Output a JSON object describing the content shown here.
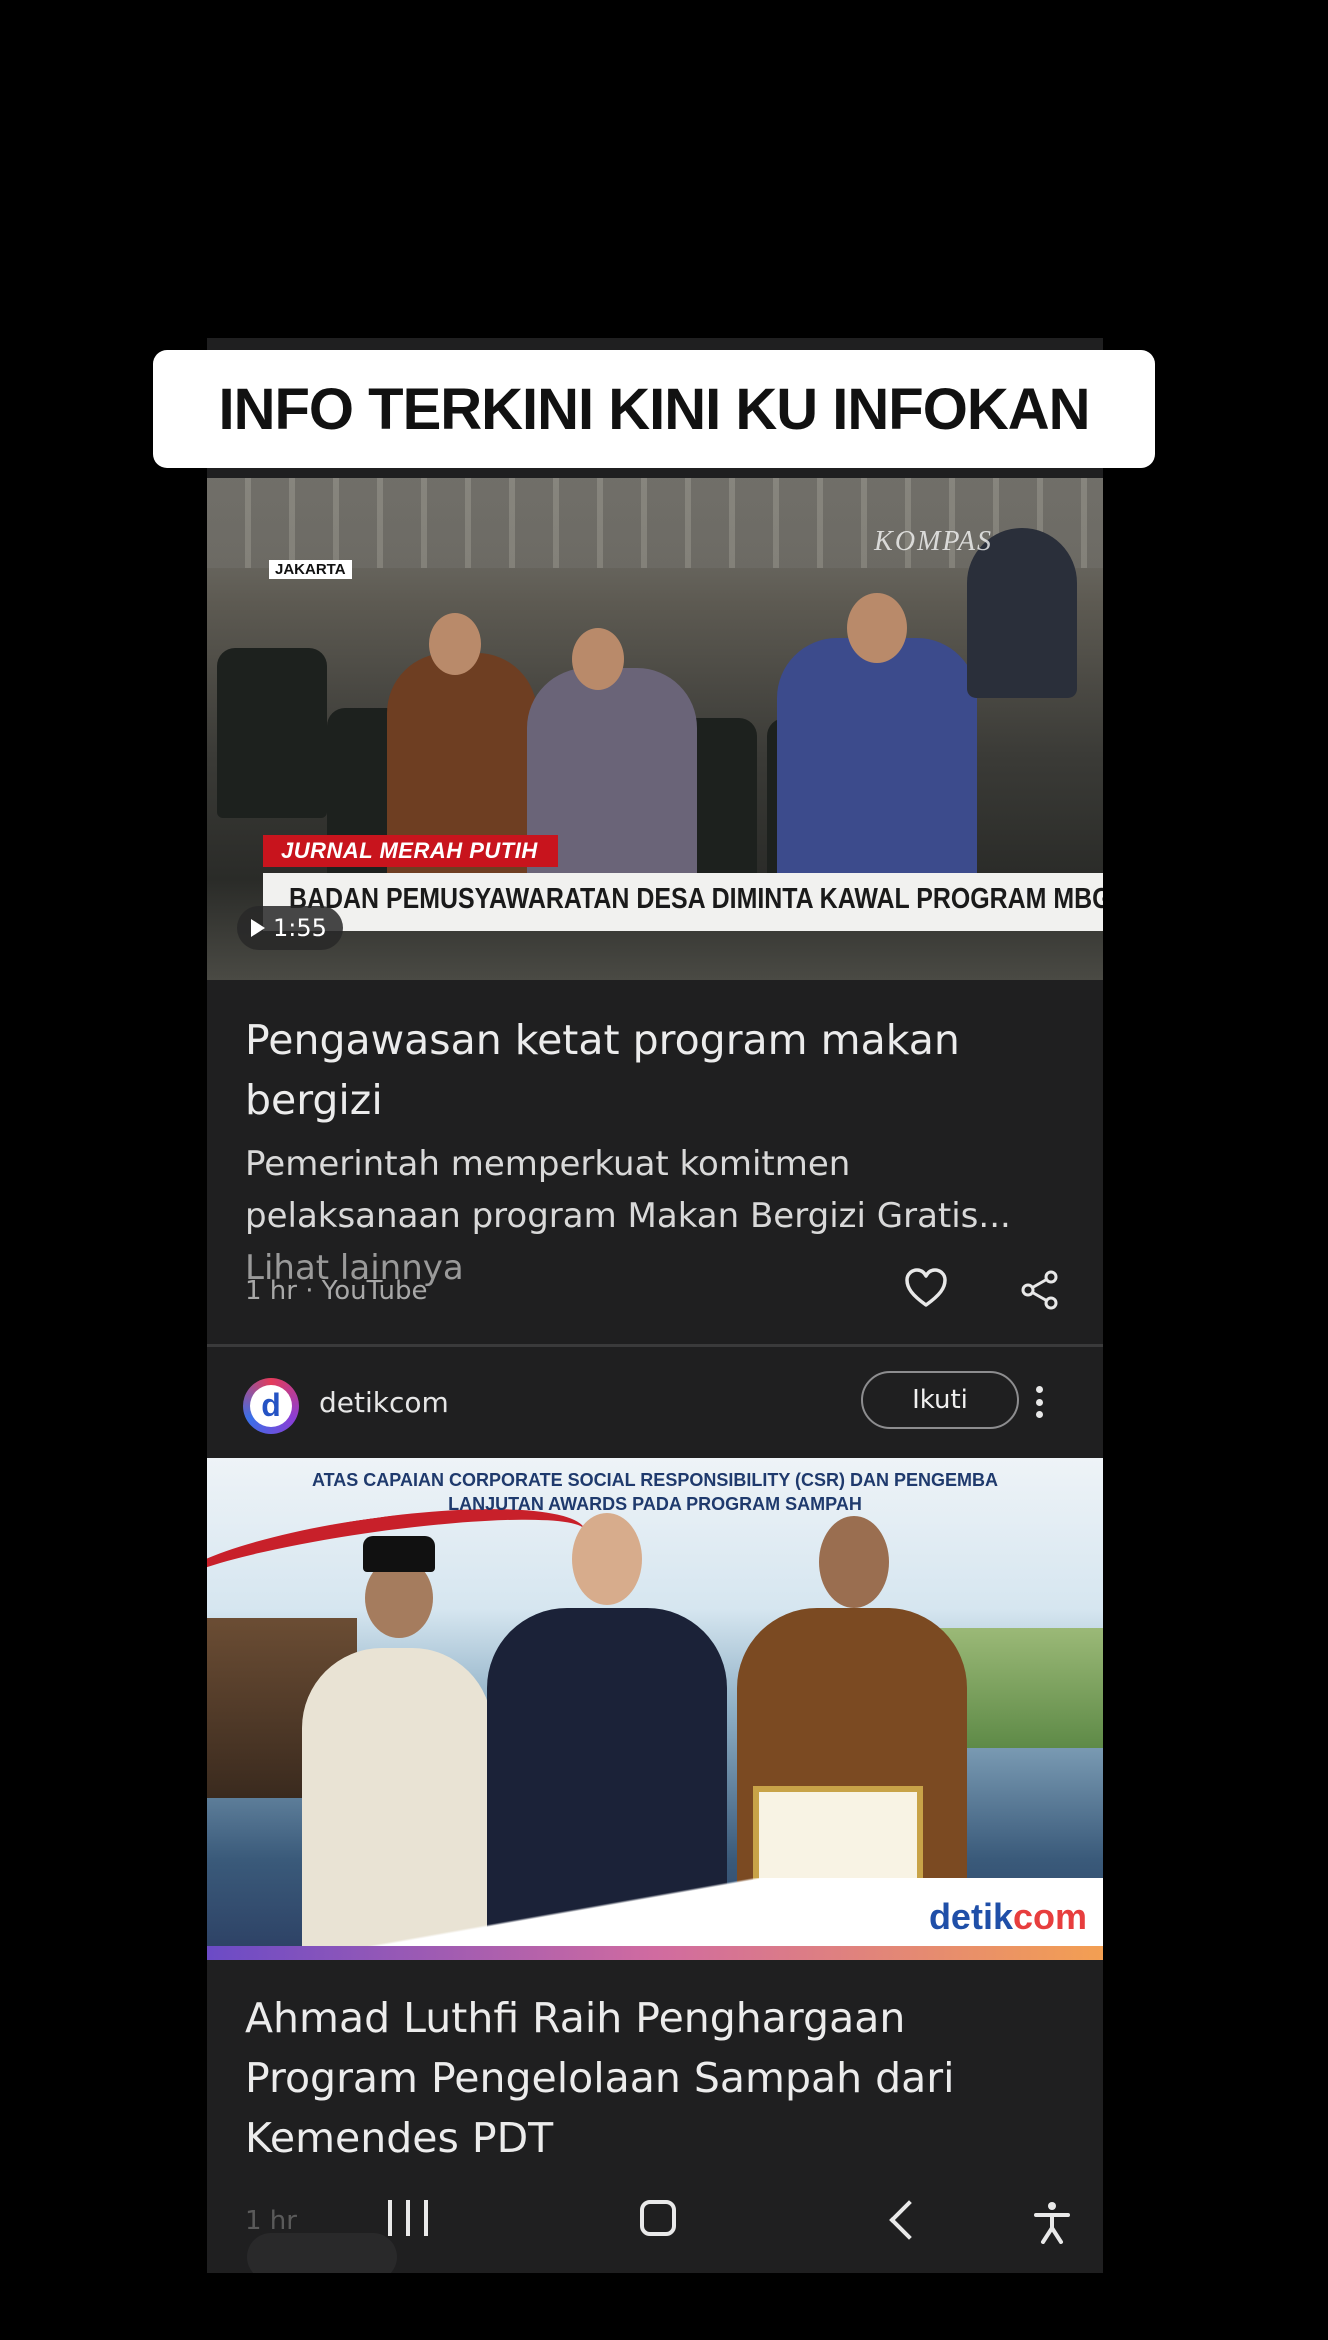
{
  "banner": {
    "text": "INFO TERKINI KINI KU INFOKAN"
  },
  "card1": {
    "location_tag": "JAKARTA",
    "watermark": "KOMPAS",
    "program_tag": "JURNAL MERAH PUTIH",
    "video_headline": "BADAN PEMUSYAWARATAN DESA DIMINTA KAWAL PROGRAM MBG",
    "duration": "1:55",
    "title": "Pengawasan ketat program makan bergizi",
    "snippet": "Pemerintah memperkuat komitmen pelaksanaan program Makan Bergizi Gratis...",
    "more_label": "Lihat lainnya",
    "meta": "1 hr · YouTube",
    "icons": {
      "like": "heart-icon",
      "share": "share-icon"
    }
  },
  "card2": {
    "source": {
      "logo_letter": "d",
      "name": "detikcom"
    },
    "follow_label": "Ikuti",
    "image_text_line1": "ATAS CAPAIAN CORPORATE SOCIAL RESPONSIBILITY (CSR) DAN PENGEMBA",
    "image_text_line2": "LANJUTAN AWARDS PADA PROGRAM SAMPAH",
    "brand_mark_a": "detik",
    "brand_mark_b": "com",
    "title": "Ahmad Luthfi Raih Penghargaan Program Pengelolaan Sampah dari Kemendes PDT",
    "meta": "1 hr"
  },
  "system_nav": {
    "icons": [
      "recents-icon",
      "home-icon",
      "back-icon",
      "accessibility-icon"
    ]
  },
  "colors": {
    "background": "#000000",
    "card": "#1f1f20",
    "accent_red": "#c8141d",
    "detik_blue": "#1f4fa8"
  }
}
